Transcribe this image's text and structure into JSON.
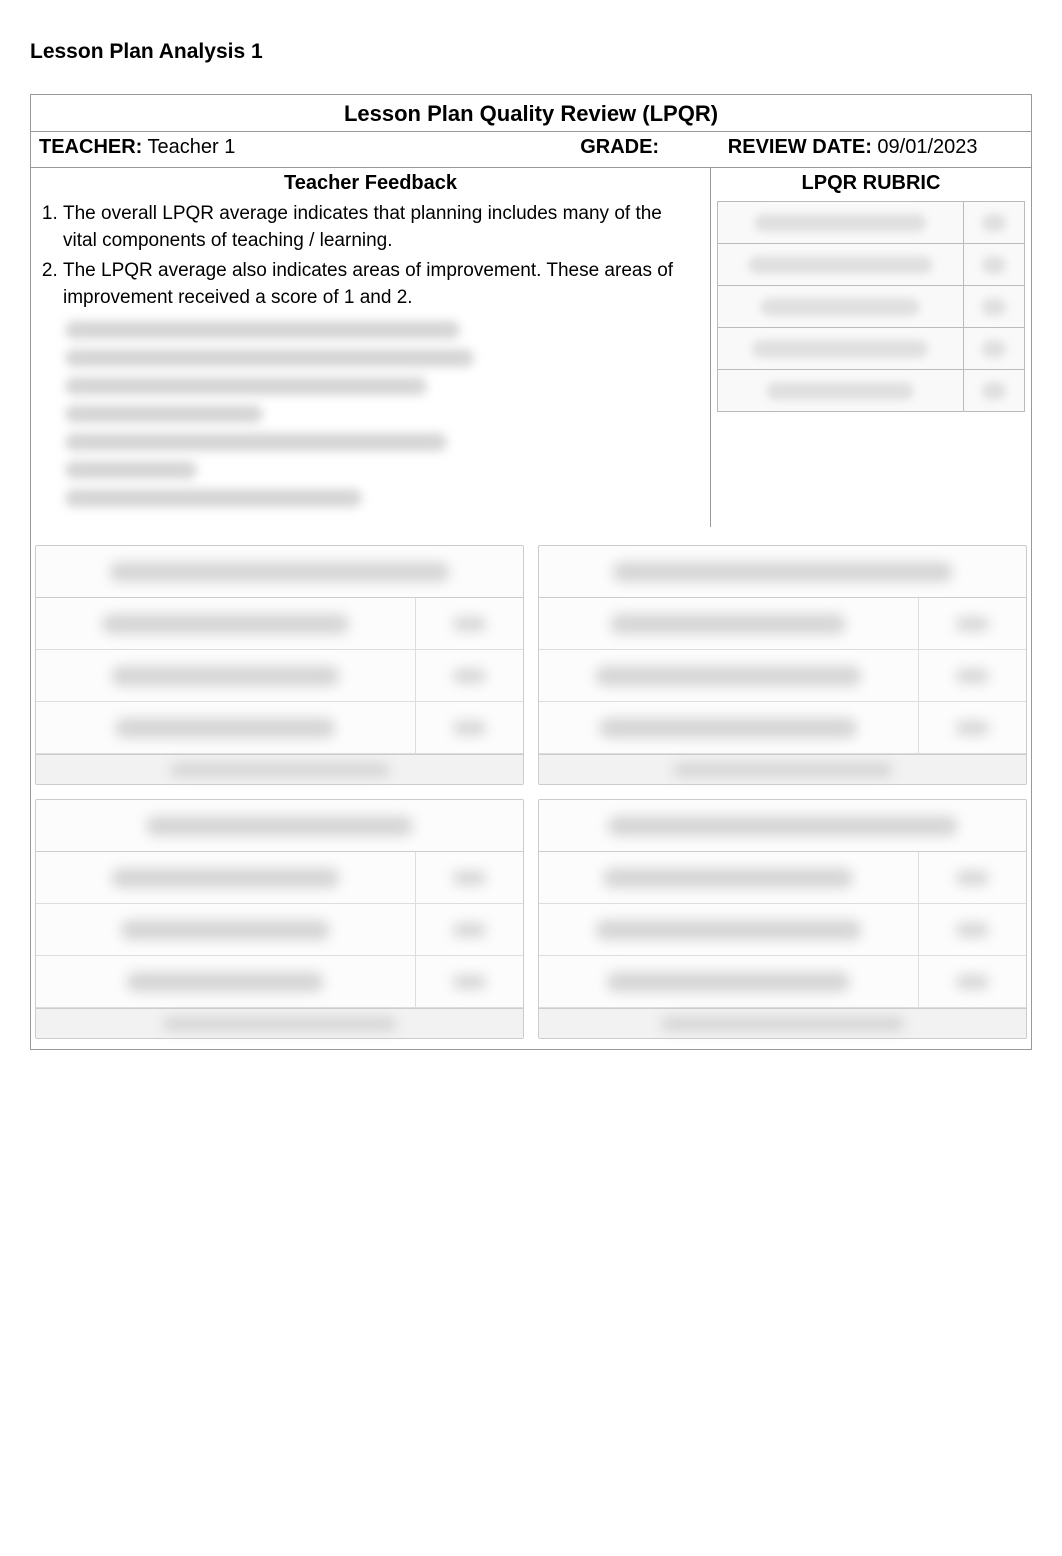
{
  "page_title": "Lesson Plan Analysis 1",
  "review_header": "Lesson Plan Quality Review (LPQR)",
  "teacher_label": "TEACHER:",
  "teacher_value": "Teacher 1",
  "grade_label": "GRADE:",
  "grade_value": "",
  "review_date_label": "REVIEW DATE:",
  "review_date_value": "09/01/2023",
  "feedback_header": "Teacher Feedback",
  "rubric_header": "LPQR RUBRIC",
  "feedback_items": [
    "The overall LPQR average indicates that planning includes many of the vital components of teaching / learning.",
    "The LPQR average also indicates areas of improvement. These areas of improvement received a score of 1 and 2."
  ]
}
